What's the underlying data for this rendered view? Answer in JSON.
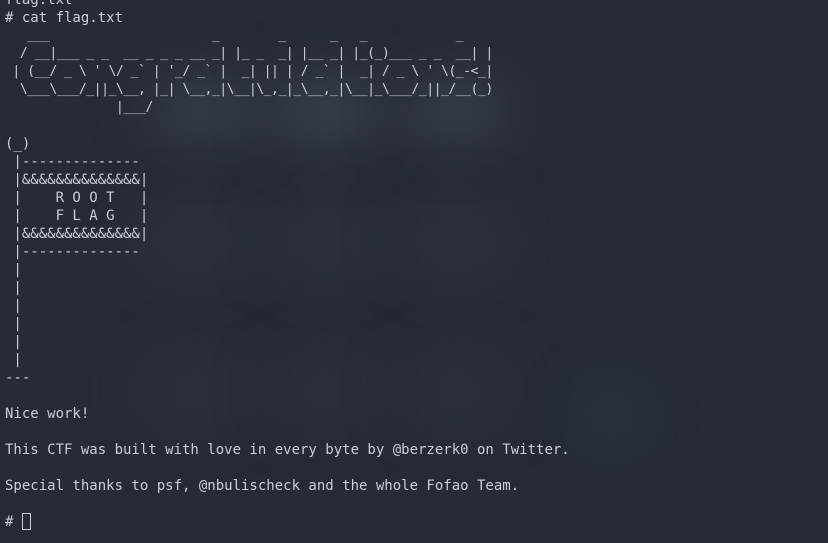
{
  "terminal": {
    "prev_output": "flag.txt",
    "command_line": "# cat flag.txt",
    "ascii_logo": "   ___                      _        _      _   _            _\n  / __|___ _ _  __ _ _ _ __ _| |_ _  _| |__ _| |_(_)___ _ _  __| |\n | (__/ _ \\ ' \\/ _` | '_/ _` |  _| || | / _` |  _| / _ \\ ' \\(_-<_|\n  \\___\\___/_||_\\__, |_| \\__,_|\\__|\\_,_|_\\__,_|\\__|_\\___/_||_/__(_)\n               |___/",
    "ascii_flag": "(_)\n |--------------\n |&&&&&&&&&&&&&&|\n |    R O O T   |\n |    F L A G   |\n |&&&&&&&&&&&&&&|\n |--------------\n |\n |\n |\n |\n |\n |\n---",
    "message_1": "Nice work!",
    "message_2": "This CTF was built with love in every byte by @berzerk0 on Twitter.",
    "message_3": "Special thanks to psf, @nbulischeck and the whole Fofao Team.",
    "prompt": "# "
  },
  "colors": {
    "background": "#262b36",
    "text": "#c9ced9"
  }
}
